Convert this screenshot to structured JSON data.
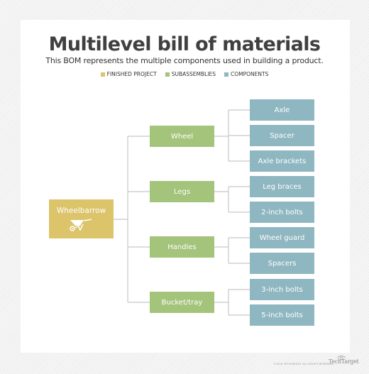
{
  "header": {
    "title": "Multilevel bill of materials",
    "subtitle": "This BOM represents the multiple components used in building a product."
  },
  "legend": [
    {
      "label": "FINISHED PROJECT",
      "color": "#dcc46a"
    },
    {
      "label": "SUBASSEMBLIES",
      "color": "#a4c37b"
    },
    {
      "label": "COMPONENTS",
      "color": "#8fb7c1"
    }
  ],
  "colors": {
    "finished": "#dcc46a",
    "subassembly": "#a4c37b",
    "component": "#8fb7c1",
    "connector": "#c8c8c8"
  },
  "tree": {
    "root": {
      "label": "Wheelbarrow",
      "icon": "wheelbarrow-icon"
    },
    "subassemblies": [
      {
        "label": "Wheel",
        "components": [
          "Axle",
          "Spacer",
          "Axle brackets"
        ]
      },
      {
        "label": "Legs",
        "components": [
          "Leg braces",
          "2-inch bolts"
        ]
      },
      {
        "label": "Handles",
        "components": [
          "Wheel guard",
          "Spacers"
        ]
      },
      {
        "label": "Bucket/tray",
        "components": [
          "3-inch bolts",
          "5-inch bolts"
        ]
      }
    ]
  },
  "footer": {
    "copyright": "©2018 TECHTARGET. ALL RIGHTS RESERVED",
    "brand": "TechTarget"
  }
}
